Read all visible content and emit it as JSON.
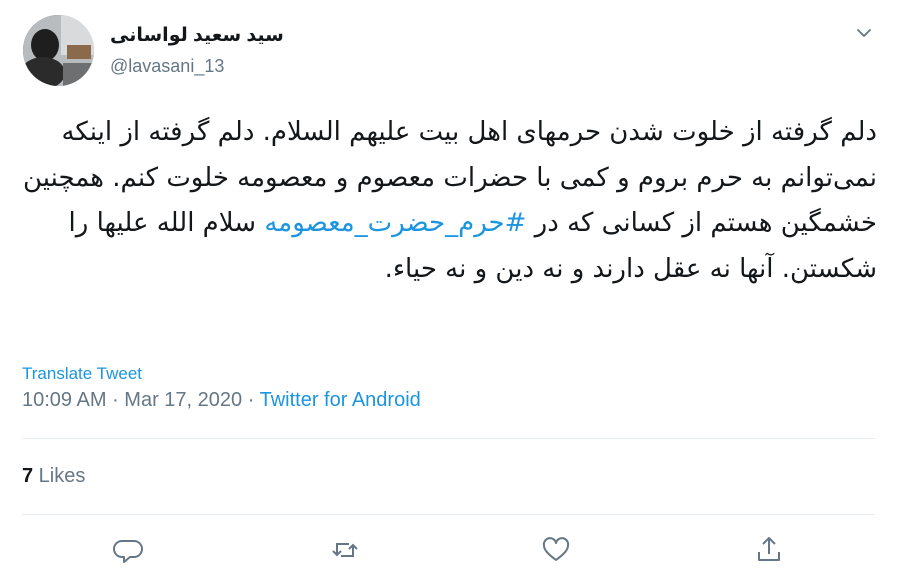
{
  "user": {
    "display_name": "سید سعید لواسانی",
    "handle": "@lavasani_13"
  },
  "tweet": {
    "text_before_hashtag": "دلم گرفته از خلوت شدن حرمهای اهل بیت علیهم السلام. دلم گرفته از اینکه نمی‌توانم به حرم بروم و کمی با حضرات معصوم و معصومه خلوت کنم. همچنین خشمگین هستم از کسانی که در ",
    "hashtag": "#حرم_حضرت_معصومه",
    "text_after_hashtag": " سلام الله علیها را شکستن. آنها نه عقل دارند و نه دین و نه حیاء."
  },
  "translate_label": "Translate Tweet",
  "meta": {
    "time": "10:09 AM",
    "separator1": " · ",
    "date": "Mar 17, 2020",
    "separator2": " · ",
    "source": "Twitter for Android"
  },
  "stats": {
    "likes_count": "7",
    "likes_label": " Likes"
  },
  "actions": {
    "reply_icon": "reply-icon",
    "retweet_icon": "retweet-icon",
    "like_icon": "heart-icon",
    "share_icon": "share-icon"
  },
  "colors": {
    "link": "#1b95e0",
    "secondary": "#657786",
    "text": "#14171a",
    "divider": "#e6ecf0"
  }
}
